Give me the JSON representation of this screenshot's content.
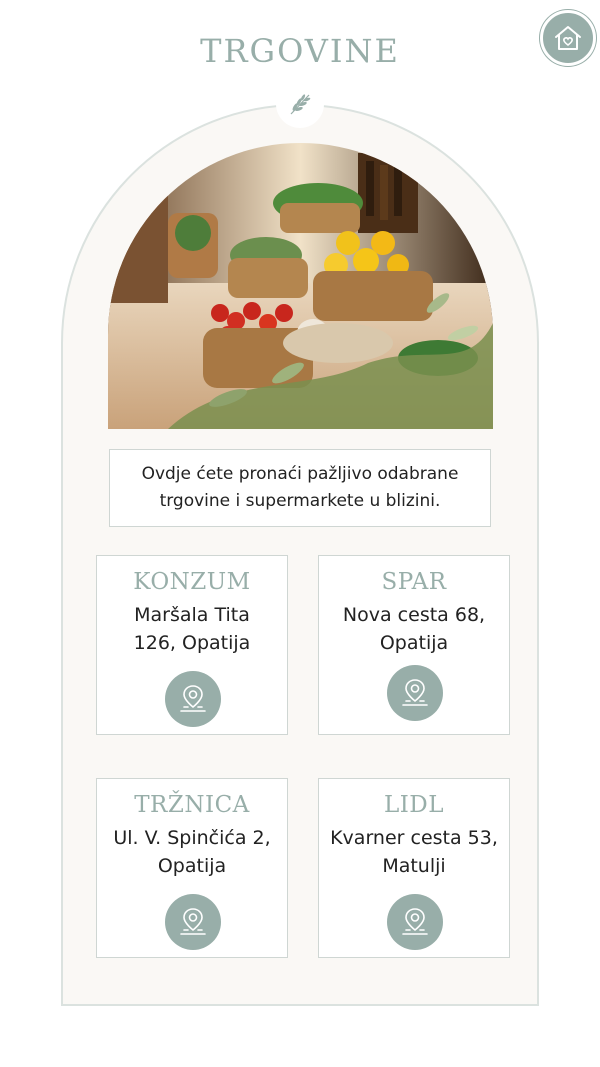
{
  "header": {
    "title": "TRGOVINE",
    "home_icon": "home-heart-icon"
  },
  "decor": {
    "sprig_icon": "olive-sprig-icon",
    "photo": "market-produce-photo"
  },
  "intro": {
    "text": "Ovdje ćete pronaći pažljivo odabrane trgovine i supermarkete u blizini."
  },
  "stores": [
    {
      "name": "KONZUM",
      "address": "Maršala Tita 126, Opatija",
      "icon": "location-pin-icon"
    },
    {
      "name": "SPAR",
      "address": "Nova cesta 68, Opatija",
      "icon": "location-pin-icon"
    },
    {
      "name": "TRŽNICA",
      "address": "Ul. V. Spinčića 2, Opatija",
      "icon": "location-pin-icon"
    },
    {
      "name": "LIDL",
      "address": "Kvarner cesta 53, Matulji",
      "icon": "location-pin-icon"
    }
  ],
  "colors": {
    "accent": "#98aea9",
    "arch_bg": "#faf8f5",
    "border": "#cfd6d3"
  }
}
